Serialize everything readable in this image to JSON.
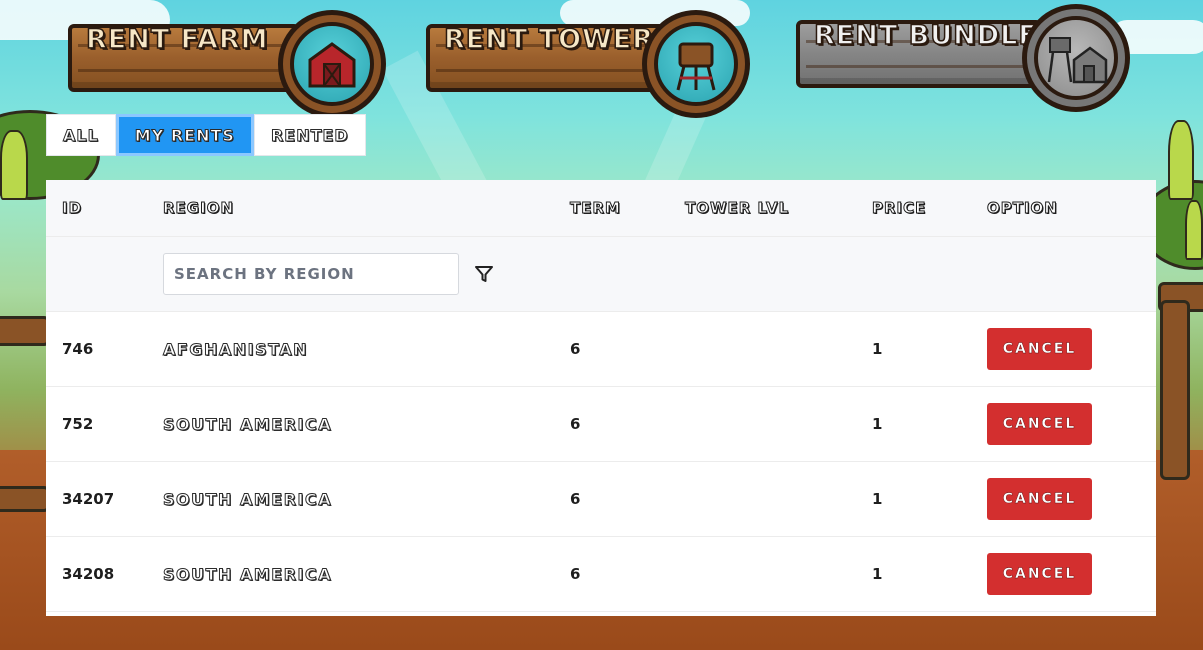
{
  "header": {
    "buttons": [
      {
        "label": "RENT FARM",
        "icon": "barn-icon"
      },
      {
        "label": "RENT TOWER",
        "icon": "water-tower-icon"
      },
      {
        "label": "RENT BUNDLE",
        "icon": "bundle-icon"
      }
    ]
  },
  "tabs": [
    {
      "label": "ALL",
      "active": false
    },
    {
      "label": "MY RENTS",
      "active": true
    },
    {
      "label": "RENTED",
      "active": false
    }
  ],
  "table": {
    "columns": {
      "id": "ID",
      "region": "REGION",
      "term": "TERM",
      "tower_lvl": "TOWER LVL",
      "price": "PRICE",
      "option": "OPTION"
    },
    "search": {
      "placeholder": "SEARCH BY REGION",
      "value": ""
    },
    "filter_icon": "filter-icon",
    "cancel_label": "CANCEL",
    "rows": [
      {
        "id": "746",
        "region": "AFGHANISTAN",
        "term": "6",
        "tower_lvl": "",
        "price": "1"
      },
      {
        "id": "752",
        "region": "SOUTH AMERICA",
        "term": "6",
        "tower_lvl": "",
        "price": "1"
      },
      {
        "id": "34207",
        "region": "SOUTH AMERICA",
        "term": "6",
        "tower_lvl": "",
        "price": "1"
      },
      {
        "id": "34208",
        "region": "SOUTH AMERICA",
        "term": "6",
        "tower_lvl": "",
        "price": "1"
      }
    ]
  },
  "colors": {
    "tab_active": "#2196f3",
    "cancel_button": "#d32f2f",
    "table_header_bg": "#f7f8fa"
  }
}
